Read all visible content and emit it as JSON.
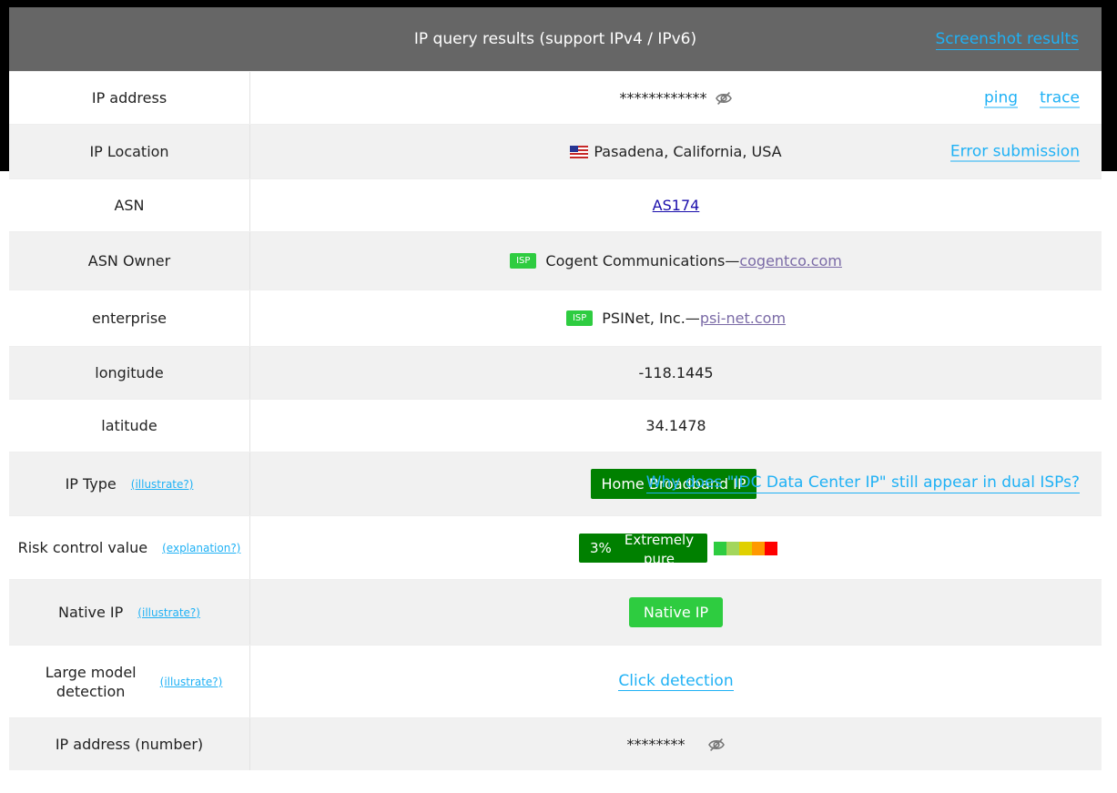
{
  "header": {
    "title": "IP query results (support IPv4 / IPv6)",
    "screenshot_link": "Screenshot results"
  },
  "rows": {
    "ip_address": {
      "label": "IP address",
      "value": "************",
      "ping": "ping",
      "trace": "trace"
    },
    "ip_location": {
      "label": "IP Location",
      "value": "Pasadena, California, USA",
      "error_link": "Error submission"
    },
    "asn": {
      "label": "ASN",
      "value": "AS174"
    },
    "asn_owner": {
      "label": "ASN Owner",
      "badge": "ISP",
      "name": "Cogent Communications—",
      "domain": "cogentco.com"
    },
    "enterprise": {
      "label": "enterprise",
      "badge": "ISP",
      "name": "PSINet, Inc.—",
      "domain": "psi-net.com"
    },
    "longitude": {
      "label": "longitude",
      "value": "-118.1445"
    },
    "latitude": {
      "label": "latitude",
      "value": "34.1478"
    },
    "ip_type": {
      "label": "IP Type",
      "hint": "(illustrate?)",
      "badge": "Home Broadband IP",
      "note": "Why does \"IDC Data Center IP\" still appear in dual ISPs?"
    },
    "risk": {
      "label": "Risk control value",
      "hint": "(explanation?)",
      "percent": "3%",
      "level": "Extremely pure",
      "scale_colors": [
        "#2ecc40",
        "#a3d65c",
        "#e0d000",
        "#ff9900",
        "#ff0000"
      ]
    },
    "native_ip": {
      "label": "Native IP",
      "hint": "(illustrate?)",
      "badge": "Native IP"
    },
    "llm": {
      "label": "Large model detection",
      "hint": "(illustrate?)",
      "link": "Click detection"
    },
    "ip_number": {
      "label": "IP address (number)",
      "value": "********"
    }
  },
  "colors": {
    "header_bg": "#666666",
    "link": "#1fb1f5",
    "green_dark": "#008000",
    "green_light": "#2ecc40"
  },
  "icons": [
    "eye-slash-icon",
    "us-flag-icon"
  ]
}
